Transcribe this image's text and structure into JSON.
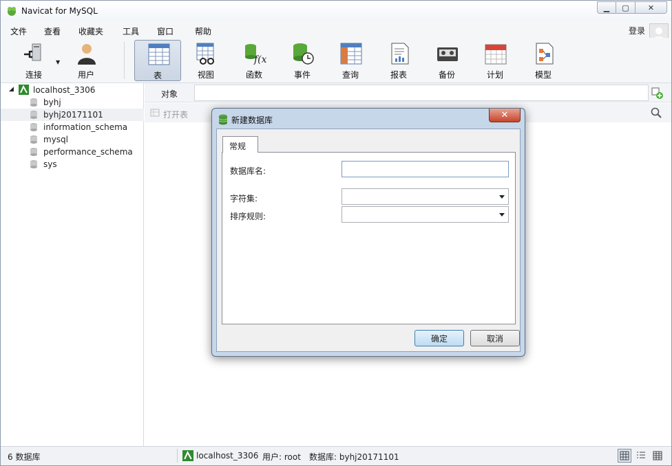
{
  "window": {
    "title": "Navicat for MySQL"
  },
  "menu": [
    "文件",
    "查看",
    "收藏夹",
    "工具",
    "窗口",
    "帮助"
  ],
  "login_label": "登录",
  "toolbar": [
    {
      "label": "连接",
      "icon": "plug-icon"
    },
    {
      "label": "用户",
      "icon": "user-icon"
    },
    {
      "label": "表",
      "icon": "table-icon",
      "active": true
    },
    {
      "label": "视图",
      "icon": "view-icon"
    },
    {
      "label": "函数",
      "icon": "function-icon"
    },
    {
      "label": "事件",
      "icon": "event-icon"
    },
    {
      "label": "查询",
      "icon": "query-icon"
    },
    {
      "label": "报表",
      "icon": "report-icon"
    },
    {
      "label": "备份",
      "icon": "backup-icon"
    },
    {
      "label": "计划",
      "icon": "calendar-icon"
    },
    {
      "label": "模型",
      "icon": "model-icon"
    }
  ],
  "tree": {
    "connection": "localhost_3306",
    "databases": [
      "byhj",
      "byhj20171101",
      "information_schema",
      "mysql",
      "performance_schema",
      "sys"
    ],
    "selected": "byhj20171101"
  },
  "objects": {
    "label": "对象",
    "open_table": "打开表"
  },
  "status": {
    "db_count": "6 数据库",
    "connection": "localhost_3306",
    "user": "用户: root",
    "database": "数据库: byhj20171101"
  },
  "dialog": {
    "title": "新建数据库",
    "tab": "常规",
    "db_name_label": "数据库名:",
    "db_name_value": "",
    "charset_label": "字符集:",
    "charset_value": "",
    "collation_label": "排序规则:",
    "collation_value": "",
    "ok": "确定",
    "cancel": "取消"
  },
  "colors": {
    "accent": "#3c7fb1",
    "selected_row": "#eef0f3",
    "db_green": "#4a9a3a"
  }
}
